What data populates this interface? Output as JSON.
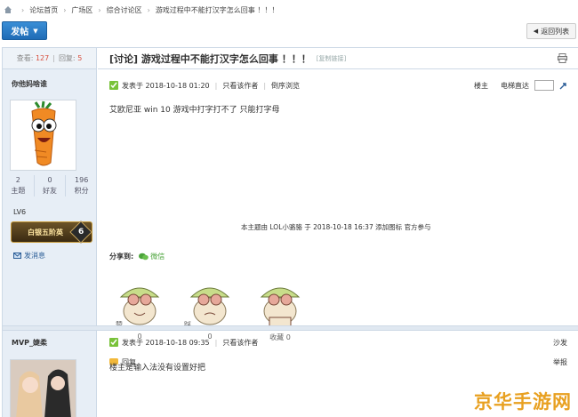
{
  "breadcrumb": [
    "论坛首页",
    "广场区",
    "综合讨论区",
    "游戏过程中不能打汉字怎么回事 ！！！"
  ],
  "toolbar": {
    "post_label": "发帖",
    "back_label": "返回列表"
  },
  "thread": {
    "views_label": "查看:",
    "views": "127",
    "replies_label": "回复:",
    "replies": "5",
    "title": "[讨论] 游戏过程中不能打汉字怎么回事 ！！！",
    "copy_link": "[复制链接]"
  },
  "posts": [
    {
      "author": "你他妈啥谁",
      "stats": [
        {
          "value": "2",
          "label": "主题"
        },
        {
          "value": "0",
          "label": "好友"
        },
        {
          "value": "196",
          "label": "积分"
        }
      ],
      "level": "LV6",
      "badge_text": "白银五阶英",
      "badge_num": "6",
      "send_msg": "发消息",
      "time": "发表于 2018-10-18 01:20",
      "only_author": "只看该作者",
      "reverse": "倒序浏览",
      "floor": "楼主",
      "jump_label": "电梯直达",
      "content": "艾欧尼亚  win 10  游戏中打字打不了  只能打字母",
      "notice": "本主题由 LOL小骆骆 于 2018-10-18 16:37 添加图标 官方参与",
      "share_label": "分享到:",
      "wechat": "微信",
      "reactions": [
        {
          "tag": "赞",
          "count": "0"
        },
        {
          "tag": "踩",
          "count": "0"
        },
        {
          "tag": "收藏",
          "count": "0"
        }
      ],
      "reply": "回复",
      "report": "举报"
    },
    {
      "author": "MVP_婕柔",
      "time": "发表于 2018-10-18 09:35",
      "only_author": "只看该作者",
      "floor": "沙发",
      "content": "楼主是输入法没有设置好把"
    }
  ],
  "watermark": "京华手游网",
  "colors": {
    "primary": "#1f6cb6",
    "sidebar": "#e7eef6",
    "accent_red": "#d9503f",
    "border": "#cdd9e6"
  }
}
